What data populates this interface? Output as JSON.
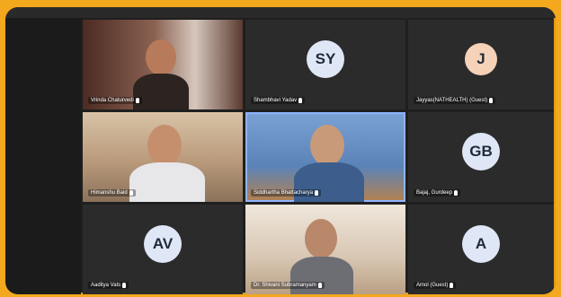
{
  "participants": [
    {
      "name": "Vrinda Chaturvedi",
      "type": "video"
    },
    {
      "name": "Shambhavi Yadav",
      "type": "avatar",
      "initials": "SY",
      "color": "#dfe6f6"
    },
    {
      "name": "Jayyas(NATHEALTH) (Guest)",
      "type": "avatar",
      "initials": "J",
      "color": "#f6d2b8"
    },
    {
      "name": "Himanshu Baid",
      "type": "video"
    },
    {
      "name": "Siddhartha Bhattacharya",
      "type": "video",
      "active": true
    },
    {
      "name": "Bajaj, Gurdeep",
      "type": "avatar",
      "initials": "GB",
      "color": "#dfe6f6"
    },
    {
      "name": "Aaditya Vats",
      "type": "avatar",
      "initials": "AV",
      "color": "#dfe6f6"
    },
    {
      "name": "Dr. Shivani Subramanyam",
      "type": "video"
    },
    {
      "name": "Amol (Guest)",
      "type": "avatar",
      "initials": "A",
      "color": "#dfe6f6"
    }
  ]
}
